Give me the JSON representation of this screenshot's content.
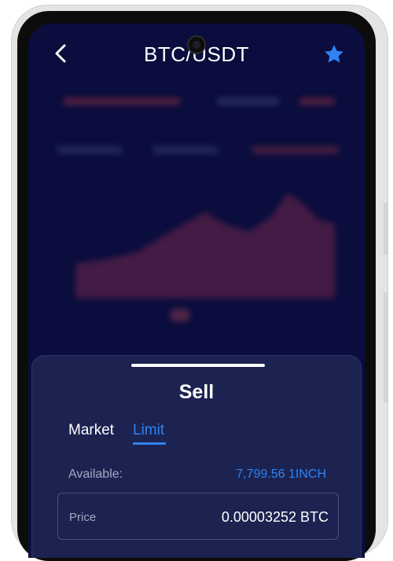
{
  "header": {
    "title": "BTC/USDT",
    "back_icon": "chevron-left-icon",
    "favorite_icon": "star-icon",
    "favorite_color": "#2f83f2"
  },
  "sheet": {
    "title": "Sell",
    "tabs": [
      {
        "label": "Market",
        "active": false
      },
      {
        "label": "Limit",
        "active": true
      }
    ],
    "available_label": "Available:",
    "available_value": "7,799.56 1INCH",
    "price_label": "Price",
    "price_value": "0.00003252 BTC"
  },
  "colors": {
    "background": "#0a0d3d",
    "sheet": "#1c2350",
    "accent": "#2f83f2"
  }
}
